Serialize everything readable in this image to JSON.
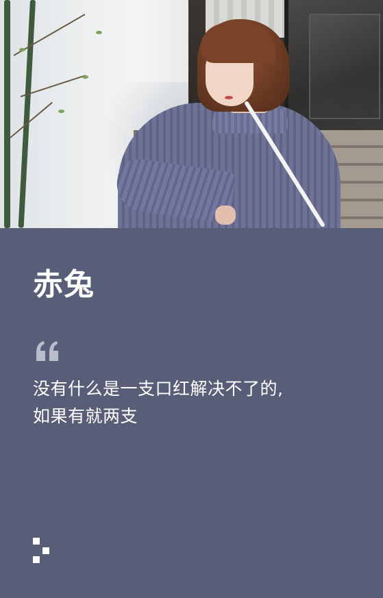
{
  "card": {
    "title": "赤兔",
    "quote_lines": [
      "没有什么是一支口红解决不了的,",
      "如果有就两支"
    ],
    "icons": {
      "quote": "open-quote-icon",
      "logo": "pixel-logo-icon"
    },
    "colors": {
      "panel_background": "#595e78",
      "text": "#ffffff",
      "quote_mark": "#b9bccb"
    }
  }
}
